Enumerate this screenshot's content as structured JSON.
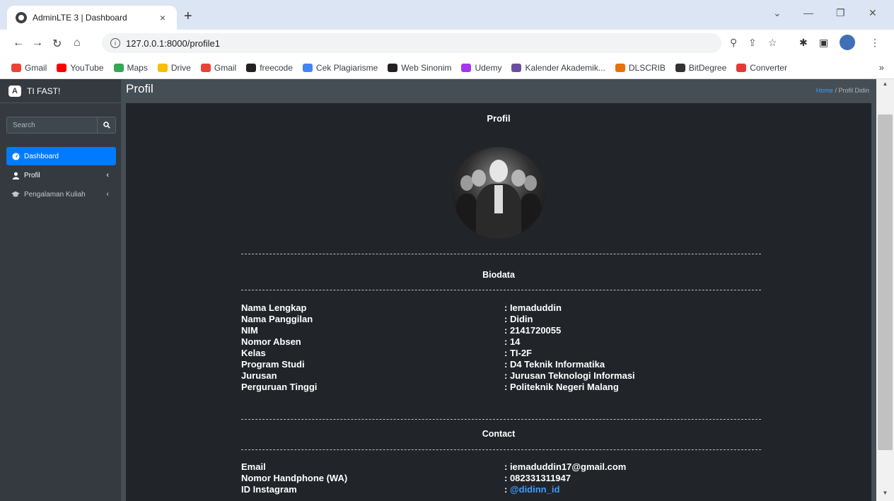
{
  "browser": {
    "tab_title": "AdminLTE 3 | Dashboard",
    "tab_close": "×",
    "new_tab": "+",
    "url": "127.0.0.1:8000/profile1",
    "bookmarks": [
      "Gmail",
      "YouTube",
      "Maps",
      "Drive",
      "Gmail",
      "freecode",
      "Cek Plagiarisme",
      "Web Sinonim",
      "Udemy",
      "Kalender Akademik...",
      "DLSCRIB",
      "BitDegree",
      "Converter"
    ],
    "bookmark_colors": [
      "#ea4335",
      "#ff0000",
      "#34a853",
      "#fbbc04",
      "#ea4335",
      "#222222",
      "#4285f4",
      "#222222",
      "#a435f0",
      "#6b4f9e",
      "#e8710a",
      "#333333",
      "#e53935"
    ],
    "more": "»"
  },
  "sidebar": {
    "brand": "TI FAST!",
    "brand_logo": "A",
    "search_placeholder": "Search",
    "items": [
      {
        "label": "Dashboard",
        "icon": "tachometer-icon"
      },
      {
        "label": "Profil",
        "icon": "user-icon"
      },
      {
        "label": "Pengalaman Kuliah",
        "icon": "graduation-cap-icon"
      }
    ]
  },
  "header": {
    "title": "Profil",
    "breadcrumb_home": "Home",
    "breadcrumb_sep": "/",
    "breadcrumb_current": "Profil Didin"
  },
  "profile": {
    "title": "Profil",
    "biodata_heading": "Biodata",
    "contact_heading": "Contact",
    "biodata": [
      {
        "label": "Nama Lengkap",
        "value": ": Iemaduddin"
      },
      {
        "label": "Nama Panggilan",
        "value": ": Didin"
      },
      {
        "label": "NIM",
        "value": ": 2141720055"
      },
      {
        "label": "Nomor Absen",
        "value": ": 14"
      },
      {
        "label": "Kelas",
        "value": ": TI-2F"
      },
      {
        "label": "Program Studi",
        "value": ": D4 Teknik Informatika"
      },
      {
        "label": "Jurusan",
        "value": ": Jurusan Teknologi Informasi"
      },
      {
        "label": "Perguruan Tinggi",
        "value": ": Politeknik Negeri Malang"
      }
    ],
    "contact": [
      {
        "label": "Email",
        "value": ": iemaduddin17@gmail.com"
      },
      {
        "label": "Nomor Handphone (WA)",
        "value": ": 082331311947"
      },
      {
        "label": "ID Instagram",
        "value_prefix": ": ",
        "value": "@didinn_id"
      }
    ]
  }
}
